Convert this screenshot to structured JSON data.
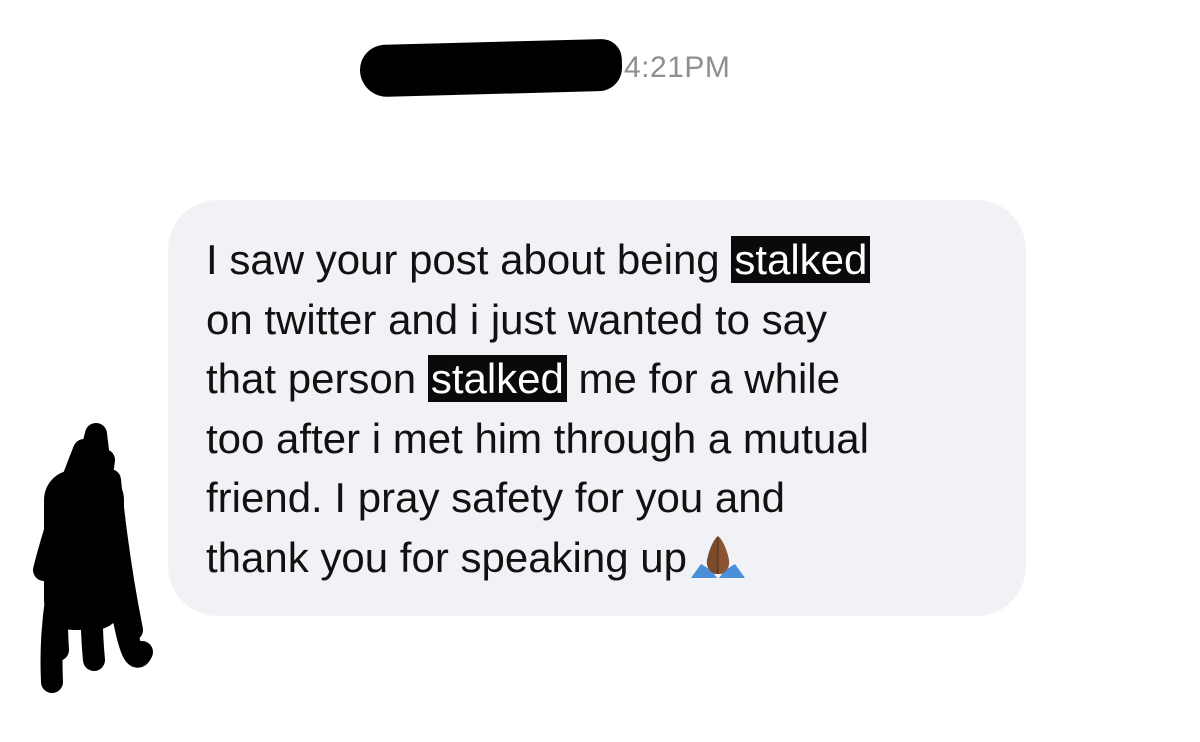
{
  "header": {
    "timestamp": "4:21PM",
    "sender_name": "redacted-black-scribble"
  },
  "message": {
    "lines": [
      {
        "before": "I saw your post about being ",
        "highlight": "stalked",
        "after": ""
      },
      {
        "before": "on twitter and i just wanted to say",
        "highlight": "",
        "after": ""
      },
      {
        "before": "that person ",
        "highlight": "stalked",
        "after": " me for a while"
      },
      {
        "before": "too after i met him through a mutual",
        "highlight": "",
        "after": ""
      },
      {
        "before": "friend. I pray safety for you and",
        "highlight": "",
        "after": ""
      },
      {
        "before": "thank you for speaking up",
        "highlight": "",
        "after": ""
      }
    ],
    "emoji": "folded-hands-icon"
  },
  "colors": {
    "bubble_bg": "#f1f2f6",
    "timestamp": "#8e8e93",
    "highlight_bg": "#0a0a0a",
    "redaction": "#000000"
  }
}
